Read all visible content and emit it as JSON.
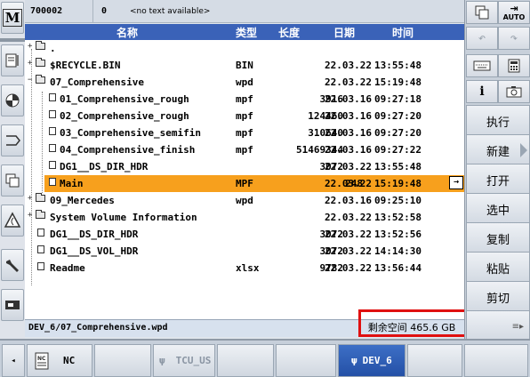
{
  "top": {
    "program": "700002",
    "channel": "0",
    "message": "<no text available>"
  },
  "columns": {
    "name": "名称",
    "type": "类型",
    "size": "长度",
    "date": "日期",
    "time": "时间"
  },
  "rows": [
    {
      "name": ".",
      "type": "",
      "size": "",
      "date": "",
      "time": ""
    },
    {
      "name": "$RECYCLE.BIN",
      "type": "BIN",
      "size": "",
      "date": "22.03.22",
      "time": "13:55:48"
    },
    {
      "name": "07_Comprehensive",
      "type": "wpd",
      "size": "",
      "date": "22.03.22",
      "time": "15:19:48"
    },
    {
      "name": "01_Comprehensive_rough",
      "type": "mpf",
      "size": "3916",
      "date": "22.03.16",
      "time": "09:27:18"
    },
    {
      "name": "02_Comprehensive_rough",
      "type": "mpf",
      "size": "124460",
      "date": "22.03.16",
      "time": "09:27:20"
    },
    {
      "name": "03_Comprehensive_semifin",
      "type": "mpf",
      "size": "310640",
      "date": "22.03.16",
      "time": "09:27:20"
    },
    {
      "name": "04_Comprehensive_finish",
      "type": "mpf",
      "size": "51469344",
      "date": "22.03.16",
      "time": "09:27:22"
    },
    {
      "name": "DG1__DS_DIR_HDR",
      "type": "",
      "size": "3072",
      "date": "22.03.22",
      "time": "13:55:48"
    },
    {
      "name": "Main",
      "type": "MPF",
      "size": "248",
      "date": "22.03.22",
      "time": "15:19:48"
    },
    {
      "name": "09_Mercedes",
      "type": "wpd",
      "size": "",
      "date": "22.03.16",
      "time": "09:25:10"
    },
    {
      "name": "System Volume Information",
      "type": "",
      "size": "",
      "date": "22.03.22",
      "time": "13:52:58"
    },
    {
      "name": "DG1__DS_DIR_HDR",
      "type": "",
      "size": "3072",
      "date": "22.03.22",
      "time": "13:52:56"
    },
    {
      "name": "DG1__DS_VOL_HDR",
      "type": "",
      "size": "3072",
      "date": "22.03.22",
      "time": "14:14:30"
    },
    {
      "name": "Readme",
      "type": "xlsx",
      "size": "9782",
      "date": "22.03.22",
      "time": "13:56:44"
    }
  ],
  "path": "DEV_6/07_Comprehensive.wpd",
  "free_space": "剩余空间 465.6 GB",
  "right_softkeys": {
    "execute": "执行",
    "new": "新建",
    "open": "打开",
    "select": "选中",
    "copy": "复制",
    "paste": "粘贴",
    "cut": "剪切"
  },
  "auto_label": "AUTO",
  "bottom_softkeys": {
    "nc": "NC",
    "tcu": "TCU_US",
    "dev": "DEV_6"
  },
  "colors": {
    "header": "#3a62b8",
    "selection": "#f7a01d",
    "highlight_box": "#e01010",
    "active_tab": "#2f5fb8"
  }
}
